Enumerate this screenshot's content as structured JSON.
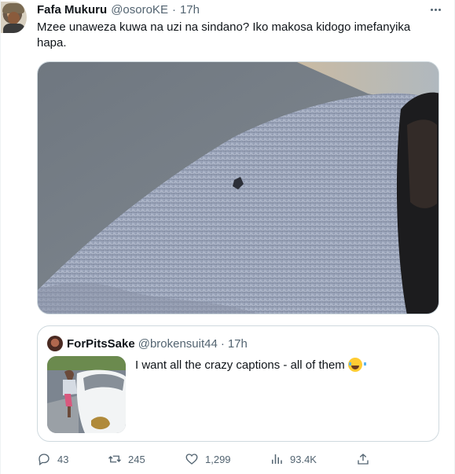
{
  "tweet": {
    "author_name": "Fafa Mukuru",
    "author_handle": "@osoroKE",
    "separator": "·",
    "time": "17h",
    "text": "Mzee unaweza kuwa na uzi na sindano? Iko makosa kidogo imefanyika hapa."
  },
  "quote": {
    "author_name": "ForPitsSake",
    "author_handle": "@brokensuit44",
    "separator": "·",
    "time": "17h",
    "text": "I want all the crazy captions - all of them"
  },
  "actions": {
    "replies": "43",
    "retweets": "245",
    "likes": "1,299",
    "views": "93.4K"
  },
  "icons": {
    "more": "more-horizontal-icon",
    "reply": "reply-icon",
    "retweet": "retweet-icon",
    "like": "heart-icon",
    "views": "views-icon",
    "share": "share-icon"
  }
}
